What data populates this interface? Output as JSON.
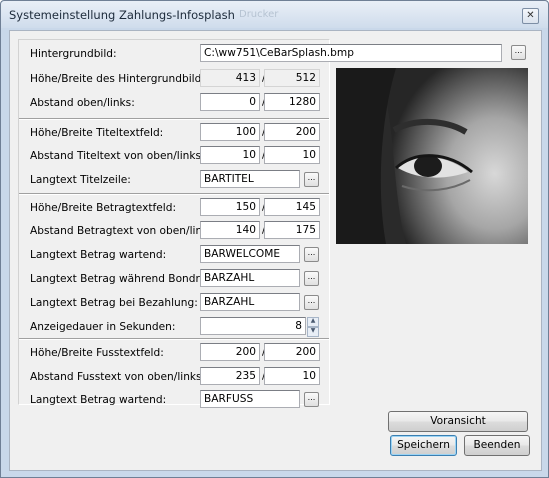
{
  "window": {
    "title": "Systemeinstellung Zahlungs-Infosplash",
    "ghost_text": "Drucker",
    "close_glyph": "✕"
  },
  "form": {
    "background_image": {
      "label": "Hintergrundbild:",
      "value": "C:\\ww751\\CeBarSplash.bmp",
      "browse": "..."
    },
    "bg_size": {
      "label": "Höhe/Breite des Hintergrundbildes:",
      "a": "413",
      "b": "512"
    },
    "bg_offset": {
      "label": "Abstand oben/links:",
      "a": "0",
      "b": "1280"
    },
    "title_size": {
      "label": "Höhe/Breite Titeltextfeld:",
      "a": "100",
      "b": "200"
    },
    "title_offset": {
      "label": "Abstand Titeltext von oben/links:",
      "a": "10",
      "b": "10"
    },
    "title_longtext": {
      "label": "Langtext Titelzeile:",
      "value": "BARTITEL",
      "browse": "..."
    },
    "amount_size": {
      "label": "Höhe/Breite Betragtextfeld:",
      "a": "150",
      "b": "145"
    },
    "amount_offset": {
      "label": "Abstand Betragtext von oben/links:",
      "a": "140",
      "b": "175"
    },
    "amount_waiting": {
      "label": "Langtext Betrag wartend:",
      "value": "BARWELCOME",
      "browse": "..."
    },
    "amount_printing": {
      "label": "Langtext Betrag während Bondruck:",
      "value": "BARZAHL",
      "browse": "..."
    },
    "amount_paying": {
      "label": "Langtext Betrag bei Bezahlung:",
      "value": "BARZAHL",
      "browse": "..."
    },
    "display_duration": {
      "label": "Anzeigedauer in Sekunden:",
      "value": "8"
    },
    "footer_size": {
      "label": "Höhe/Breite Fusstextfeld:",
      "a": "200",
      "b": "200"
    },
    "footer_offset": {
      "label": "Abstand Fusstext von oben/links:",
      "a": "235",
      "b": "10"
    },
    "footer_waiting": {
      "label": "Langtext Betrag wartend:",
      "value": "BARFUSS",
      "browse": "..."
    },
    "slash": "/"
  },
  "buttons": {
    "preview": "Voransicht",
    "save": "Speichern",
    "close": "Beenden"
  },
  "spinner": {
    "up": "▲",
    "down": "▼"
  }
}
